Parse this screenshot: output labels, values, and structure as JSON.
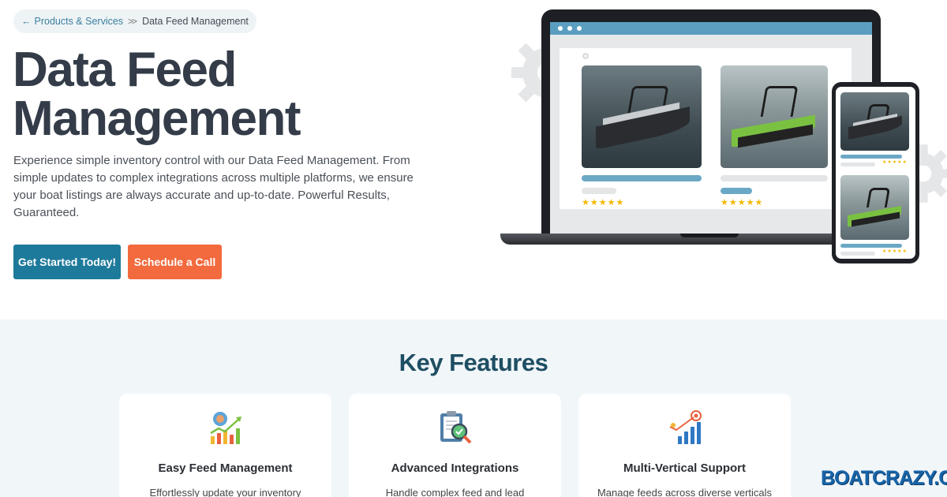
{
  "breadcrumb": {
    "parent": "Products & Services",
    "current": "Data Feed Management"
  },
  "hero": {
    "title_line1": "Data Feed",
    "title_line2": "Management",
    "description": "Experience simple inventory control with our Data Feed Management. From simple updates to complex integrations across multiple platforms, we ensure your boat listings are always accurate and up-to-date. Powerful Results, Guaranteed.",
    "primary_button": "Get Started Today!",
    "secondary_button": "Schedule a Call"
  },
  "listing_stars": "★★★★★",
  "features": {
    "title": "Key Features",
    "cards": [
      {
        "title": "Easy Feed Management",
        "text": "Effortlessly update your inventory"
      },
      {
        "title": "Advanced Integrations",
        "text": "Handle complex feed and lead"
      },
      {
        "title": "Multi-Vertical Support",
        "text": "Manage feeds across diverse verticals"
      }
    ]
  },
  "logo_text": "BOATCRAZY.COM",
  "colors": {
    "primary": "#1e7a9b",
    "secondary": "#f26a3d",
    "heading": "#333c48",
    "feature_heading": "#1e4e63",
    "star": "#f5b800"
  }
}
